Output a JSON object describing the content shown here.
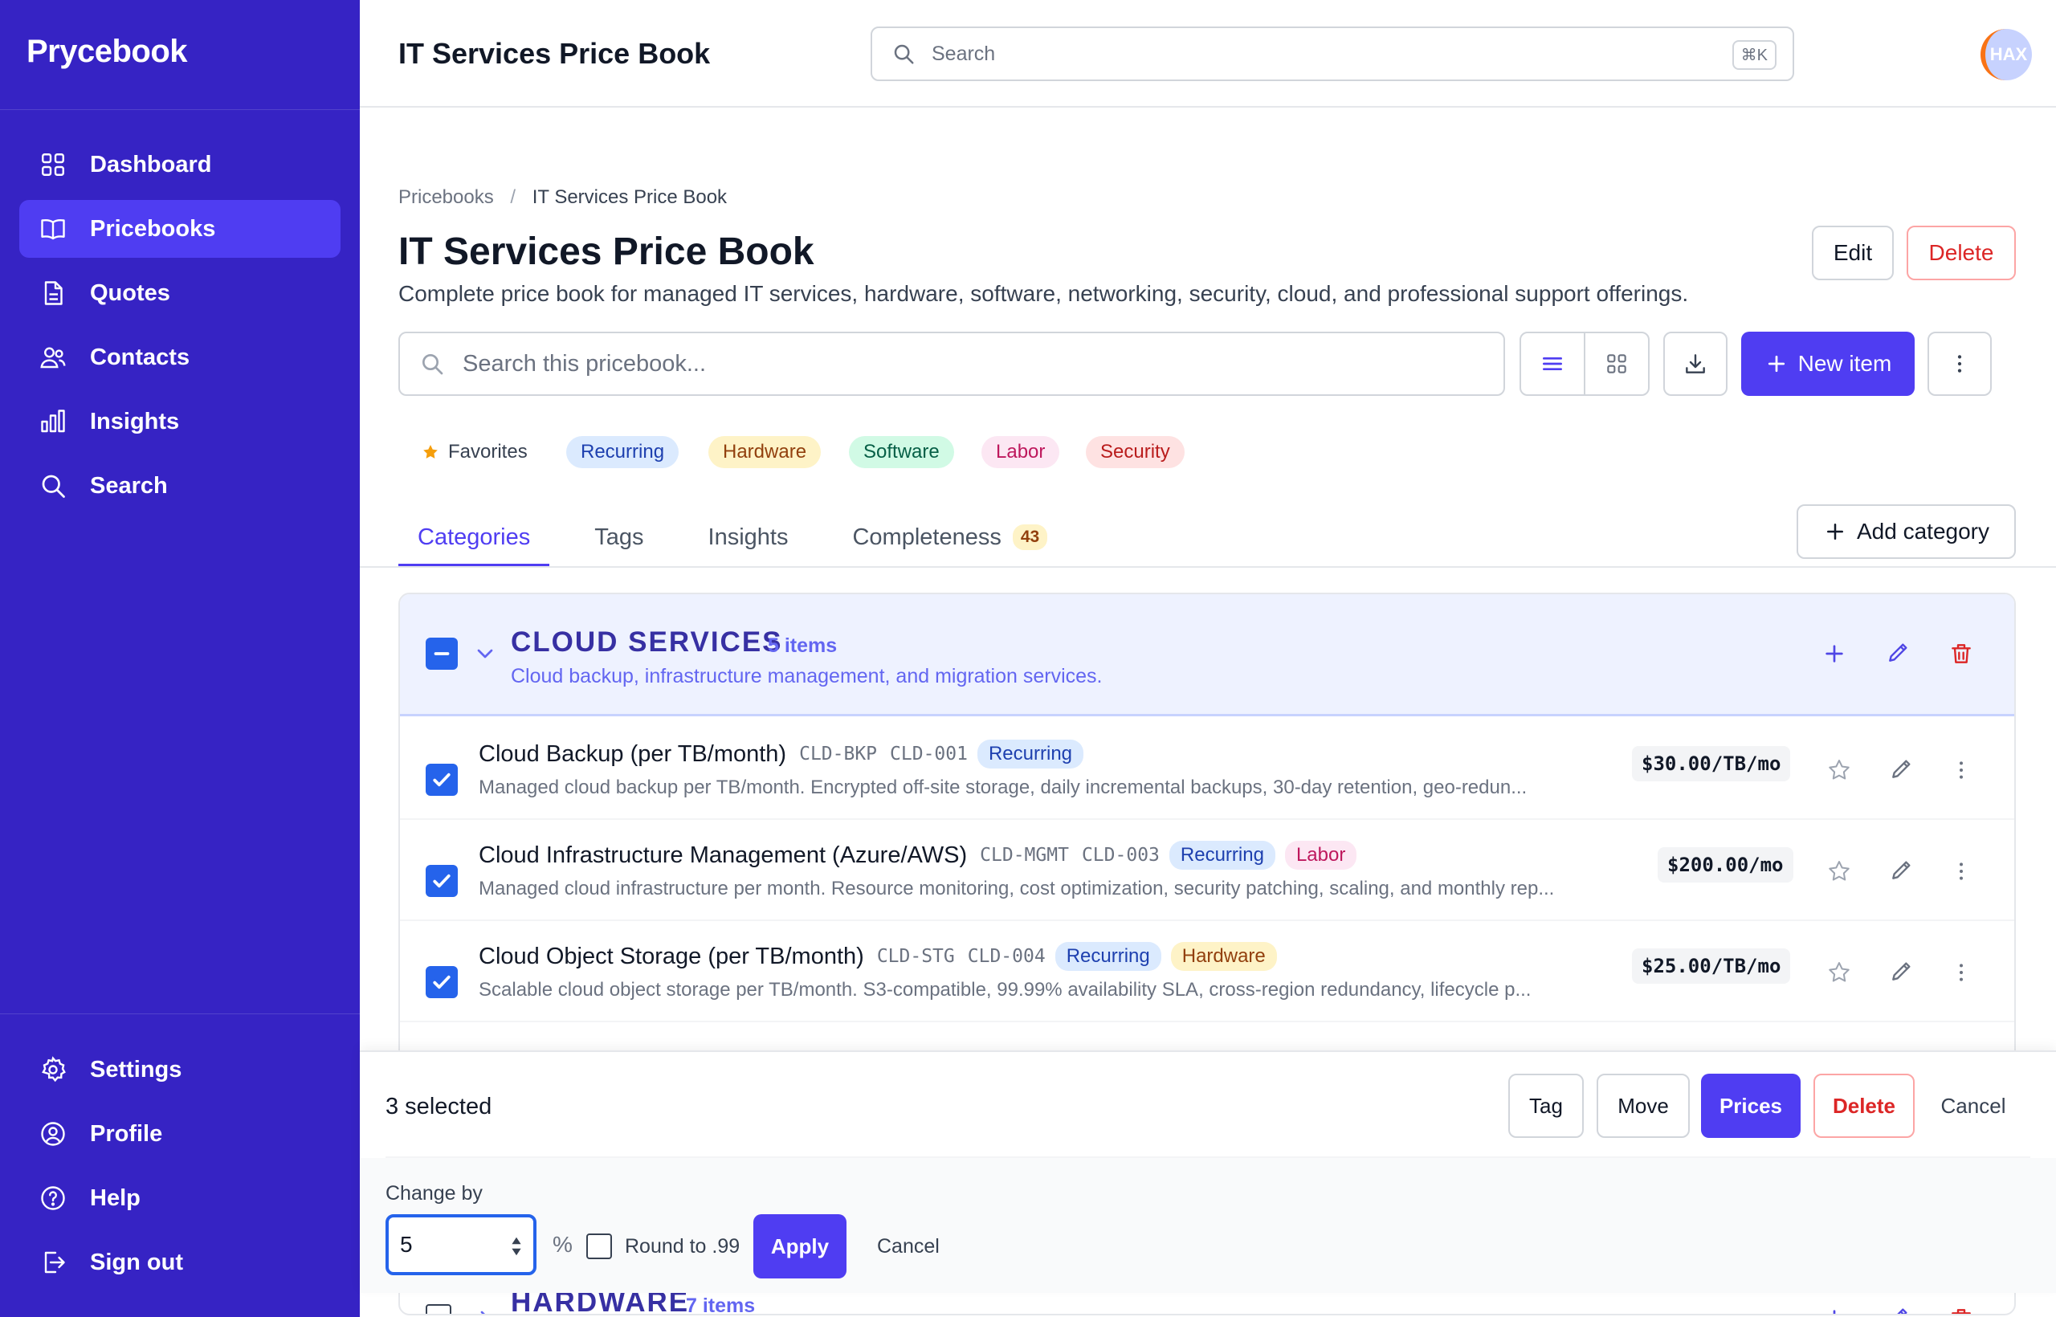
{
  "app": {
    "name": "Prycebook"
  },
  "sidebar": {
    "items": [
      {
        "label": "Dashboard",
        "icon": "grid-icon"
      },
      {
        "label": "Pricebooks",
        "icon": "book-icon",
        "active": true
      },
      {
        "label": "Quotes",
        "icon": "document-icon"
      },
      {
        "label": "Contacts",
        "icon": "users-icon"
      },
      {
        "label": "Insights",
        "icon": "bar-chart-icon"
      },
      {
        "label": "Search",
        "icon": "search-icon"
      }
    ],
    "bottom_items": [
      {
        "label": "Settings",
        "icon": "gear-icon"
      },
      {
        "label": "Profile",
        "icon": "user-circle-icon"
      },
      {
        "label": "Help",
        "icon": "help-icon"
      },
      {
        "label": "Sign out",
        "icon": "sign-out-icon"
      }
    ]
  },
  "header": {
    "title": "IT Services Price Book",
    "search_placeholder": "Search",
    "shortcut": "⌘K",
    "avatar_text": "HAX"
  },
  "breadcrumb": {
    "root": "Pricebooks",
    "separator": "/",
    "current": "IT Services Price Book"
  },
  "page": {
    "title": "IT Services Price Book",
    "description": "Complete price book for managed IT services, hardware, software, networking, security, cloud, and professional support offerings.",
    "edit_label": "Edit",
    "delete_label": "Delete"
  },
  "toolbar": {
    "search_placeholder": "Search this pricebook...",
    "new_item_label": "New item"
  },
  "filters": {
    "favorites": "Favorites",
    "tags": [
      "Recurring",
      "Hardware",
      "Software",
      "Labor",
      "Security"
    ]
  },
  "tabs": {
    "items": [
      "Categories",
      "Tags",
      "Insights",
      "Completeness"
    ],
    "completeness_badge": "43",
    "add_category_label": "Add category"
  },
  "category": {
    "title": "CLOUD SERVICES",
    "count": "5 items",
    "description": "Cloud backup, infrastructure management, and migration services.",
    "items": [
      {
        "name": "Cloud Backup (per TB/month)",
        "codes": [
          "CLD-BKP",
          "CLD-001"
        ],
        "tags": [
          "Recurring"
        ],
        "description": "Managed cloud backup per TB/month. Encrypted off-site storage, daily incremental backups, 30-day retention, geo-redun...",
        "price": "$30.00/TB/mo",
        "checked": true
      },
      {
        "name": "Cloud Infrastructure Management (Azure/AWS)",
        "codes": [
          "CLD-MGMT",
          "CLD-003"
        ],
        "tags": [
          "Recurring",
          "Labor"
        ],
        "description": "Managed cloud infrastructure per month. Resource monitoring, cost optimization, security patching, scaling, and monthly rep...",
        "price": "$200.00/mo",
        "checked": true
      },
      {
        "name": "Cloud Object Storage (per TB/month)",
        "codes": [
          "CLD-STG",
          "CLD-004"
        ],
        "tags": [
          "Recurring",
          "Hardware"
        ],
        "description": "Scalable cloud object storage per TB/month. S3-compatible, 99.99% availability SLA, cross-region redundancy, lifecycle p...",
        "price": "$25.00/TB/mo",
        "checked": true
      }
    ]
  },
  "next_category": {
    "title": "HARDWARE",
    "count": "7 items"
  },
  "bulk": {
    "selected_label": "3 selected",
    "tag_label": "Tag",
    "move_label": "Move",
    "prices_label": "Prices",
    "delete_label": "Delete",
    "cancel_label": "Cancel",
    "change_by_label": "Change by",
    "change_value": "5",
    "percent_symbol": "%",
    "round_label": "Round to .99",
    "round_checked": false,
    "apply_label": "Apply",
    "cancel2_label": "Cancel"
  },
  "colors": {
    "sidebar": "#3623c4",
    "primary": "#4f3df2",
    "danger": "#dc2626",
    "checkbox": "#2563eb"
  }
}
